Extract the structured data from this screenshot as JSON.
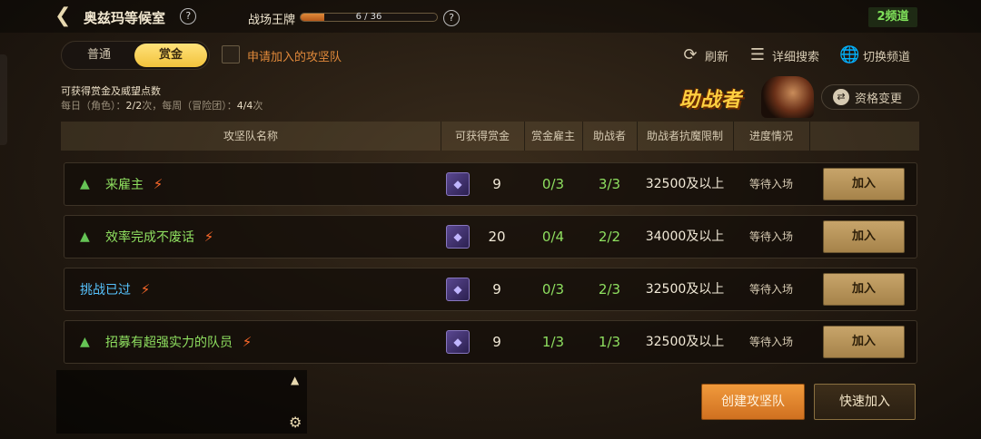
{
  "header": {
    "title": "奥兹玛等候室",
    "rank_label": "战场王牌",
    "rank_progress_text": "6 / 36",
    "rank_progress": 0.17,
    "channel": "2频道"
  },
  "toggle": {
    "normal": "普通",
    "bounty": "赏金"
  },
  "apply_checkbox_label": "申请加入的攻坚队",
  "tools": {
    "refresh": "刷新",
    "search": "详细搜索",
    "switch_channel": "切换频道"
  },
  "info": {
    "title": "可获得赏金及威望点数",
    "daily_prefix": "每日（角色）：",
    "daily_value": "2/2",
    "daily_suffix": "次，每周（冒险团）：",
    "weekly_value": "4/4",
    "weekly_suffix": "次"
  },
  "helper_logo": "助战者",
  "qualification_button": "资格变更",
  "table": {
    "headers": [
      "攻坚队名称",
      "可获得赏金",
      "赏金雇主",
      "助战者",
      "助战者抗魔限制",
      "进度情况"
    ],
    "rows": [
      {
        "name": "来雇主",
        "name_color": "green",
        "bounty": "9",
        "employer": "0/3",
        "helpers": "3/3",
        "limit": "32500及以上",
        "status": "等待入场",
        "join": "加入"
      },
      {
        "name": "效率完成不废话",
        "name_color": "green",
        "bounty": "20",
        "employer": "0/4",
        "helpers": "2/2",
        "limit": "34000及以上",
        "status": "等待入场",
        "join": "加入"
      },
      {
        "name": "挑战已过",
        "name_color": "blue",
        "bounty": "9",
        "employer": "0/3",
        "helpers": "2/3",
        "limit": "32500及以上",
        "status": "等待入场",
        "join": "加入"
      },
      {
        "name": "招募有超强实力的队员",
        "name_color": "green",
        "bounty": "9",
        "employer": "1/3",
        "helpers": "1/3",
        "limit": "32500及以上",
        "status": "等待入场",
        "join": "加入"
      }
    ]
  },
  "bottom": {
    "create": "创建攻坚队",
    "quick_join": "快速加入"
  },
  "icons": {
    "back": "back-arrow-icon",
    "help": "help-icon",
    "refresh": "refresh-icon",
    "filter": "filter-icon",
    "globe": "globe-icon",
    "crew": "crew-icon",
    "alarm": "alarm-icon",
    "gem": "bounty-gem-icon",
    "chevron": "chevron-up-icon",
    "gear": "gear-icon"
  },
  "colors": {
    "accent_gold": "#f2c33c",
    "green": "#8fe060",
    "blue": "#57c4ff",
    "orange": "#e0893a"
  }
}
